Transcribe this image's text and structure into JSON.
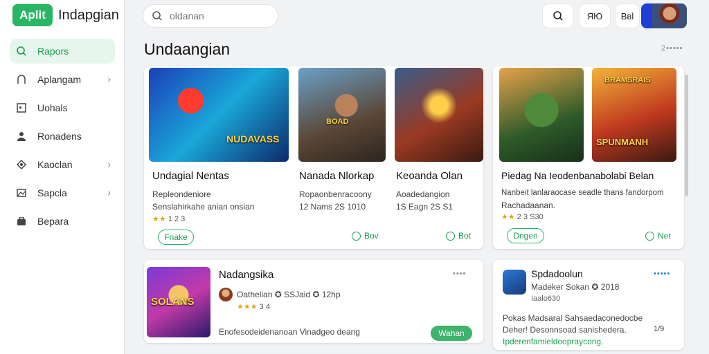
{
  "brand": {
    "logo_text": "Aplit",
    "name": "Indapgian"
  },
  "sidebar": {
    "items": [
      {
        "icon": "search-icon",
        "glyph": "⊙",
        "label": "Rapors",
        "chevron": false,
        "active": true
      },
      {
        "icon": "bell-icon",
        "glyph": "∩",
        "label": "Aplangam",
        "chevron": true
      },
      {
        "icon": "square-icon",
        "glyph": "□",
        "label": "Uohals",
        "chevron": false
      },
      {
        "icon": "user-icon",
        "glyph": "●",
        "label": "Ronadens",
        "chevron": false
      },
      {
        "icon": "tag-icon",
        "glyph": "◈",
        "label": "Kaoclan",
        "chevron": true
      },
      {
        "icon": "image-icon",
        "glyph": "▣",
        "label": "Sapcla",
        "chevron": true
      },
      {
        "icon": "bag-icon",
        "glyph": "▤",
        "label": "Bepara",
        "chevron": false
      }
    ]
  },
  "search": {
    "value": "",
    "placeholder": "oldanan"
  },
  "header": {
    "btn_search_glyph": "⌕",
    "btn_2": "ЯЮ",
    "btn_3": "Ввl"
  },
  "section": {
    "title": "Undaangian",
    "more": "2•••••"
  },
  "cards": {
    "c1": {
      "title": "Undagial Nentas",
      "line1": "Repleondeniore",
      "line2": "Senslahirkahe anian onsian",
      "rating": "1 2 3",
      "art_label": "NUDAVASS",
      "pill": "Fnake"
    },
    "c2": {
      "title": "Nanada Nlorkap",
      "line1": "Ropaonbenracoony",
      "line2": "12 Nams 2S 1010",
      "art_label": "BOAD",
      "link": "Bov"
    },
    "c3": {
      "title": "Keoanda Olan",
      "line1": "Aoadedangion",
      "line2": "1S Eagn 2S S1",
      "link": "Bot"
    },
    "c4": {
      "title": "Piedag Na Ieodenbanabolabi Belan",
      "line1": "Nanbeit lanlaraocase seadle thans fandorpom",
      "line2": "Rachadaanan.",
      "rating": "2 3 S30",
      "art_label_top": "BRAMSRAIS",
      "art_label_bottom": "SPUNMANH",
      "pill": "Dngen",
      "link": "Ner"
    },
    "c5": {
      "title": "Nadangsika",
      "meta": "Oathelian ✪ SSJaid ✪ 12hp",
      "rating": "3 4",
      "art_label": "SOLANS",
      "desc": "Enofesodeidenanoan Vinadgeo deang",
      "button": "Wahan",
      "more": "••••"
    },
    "c6": {
      "title": "Spdadoolun",
      "meta": "Madeker Sokan ✪ 2018",
      "sub": "Iaalo630",
      "desc1": "Pokas Madsaral Sahsaedaconedocbe",
      "desc2": "Deher! Desonnsoad sanishedera.",
      "desc3": "Ipderenfamieldoopraycong.",
      "count": "1/9",
      "more": "•••••"
    }
  }
}
